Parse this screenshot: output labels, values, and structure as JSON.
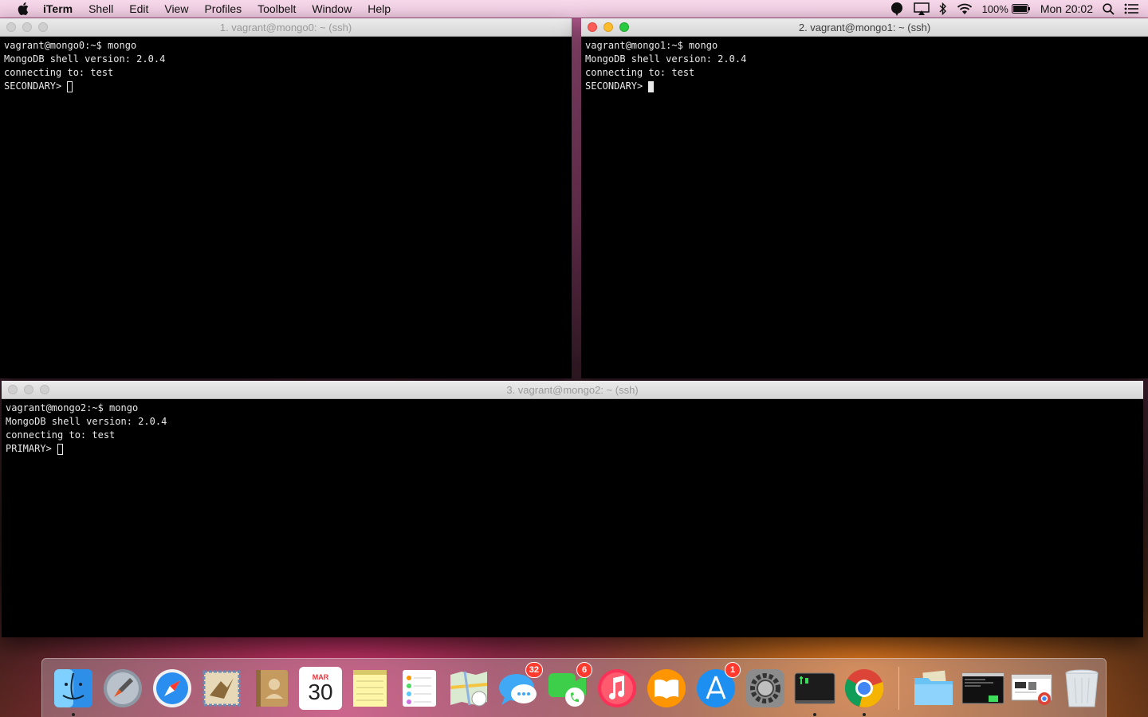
{
  "menubar": {
    "app_name": "iTerm",
    "menus": [
      "Shell",
      "Edit",
      "View",
      "Profiles",
      "Toolbelt",
      "Window",
      "Help"
    ],
    "battery": "100%",
    "clock": "Mon 20:02"
  },
  "windows": [
    {
      "title": "1. vagrant@mongo0: ~ (ssh)",
      "active": false,
      "lines": [
        "vagrant@mongo0:~$ mongo",
        "MongoDB shell version: 2.0.4",
        "connecting to: test"
      ],
      "prompt": "SECONDARY>"
    },
    {
      "title": "2. vagrant@mongo1: ~ (ssh)",
      "active": true,
      "lines": [
        "vagrant@mongo1:~$ mongo",
        "MongoDB shell version: 2.0.4",
        "connecting to: test"
      ],
      "prompt": "SECONDARY>"
    },
    {
      "title": "3. vagrant@mongo2: ~ (ssh)",
      "active": false,
      "lines": [
        "vagrant@mongo2:~$ mongo",
        "MongoDB shell version: 2.0.4",
        "connecting to: test"
      ],
      "prompt": "PRIMARY>"
    }
  ],
  "dock": {
    "calendar": {
      "month": "MAR",
      "day": "30"
    },
    "badges": {
      "messages": "32",
      "facetime": "6",
      "appstore": "1"
    },
    "apps": [
      "finder-icon",
      "launchpad-icon",
      "safari-icon",
      "mail-icon",
      "contacts-icon",
      "calendar-icon",
      "notes-icon",
      "reminders-icon",
      "maps-icon",
      "messages-icon",
      "facetime-icon",
      "itunes-icon",
      "ibooks-icon",
      "appstore-icon",
      "system-preferences-icon",
      "terminal-icon",
      "chrome-icon",
      "downloads-folder-icon",
      "minimized-terminal-icon",
      "minimized-chrome-icon",
      "trash-icon"
    ]
  }
}
